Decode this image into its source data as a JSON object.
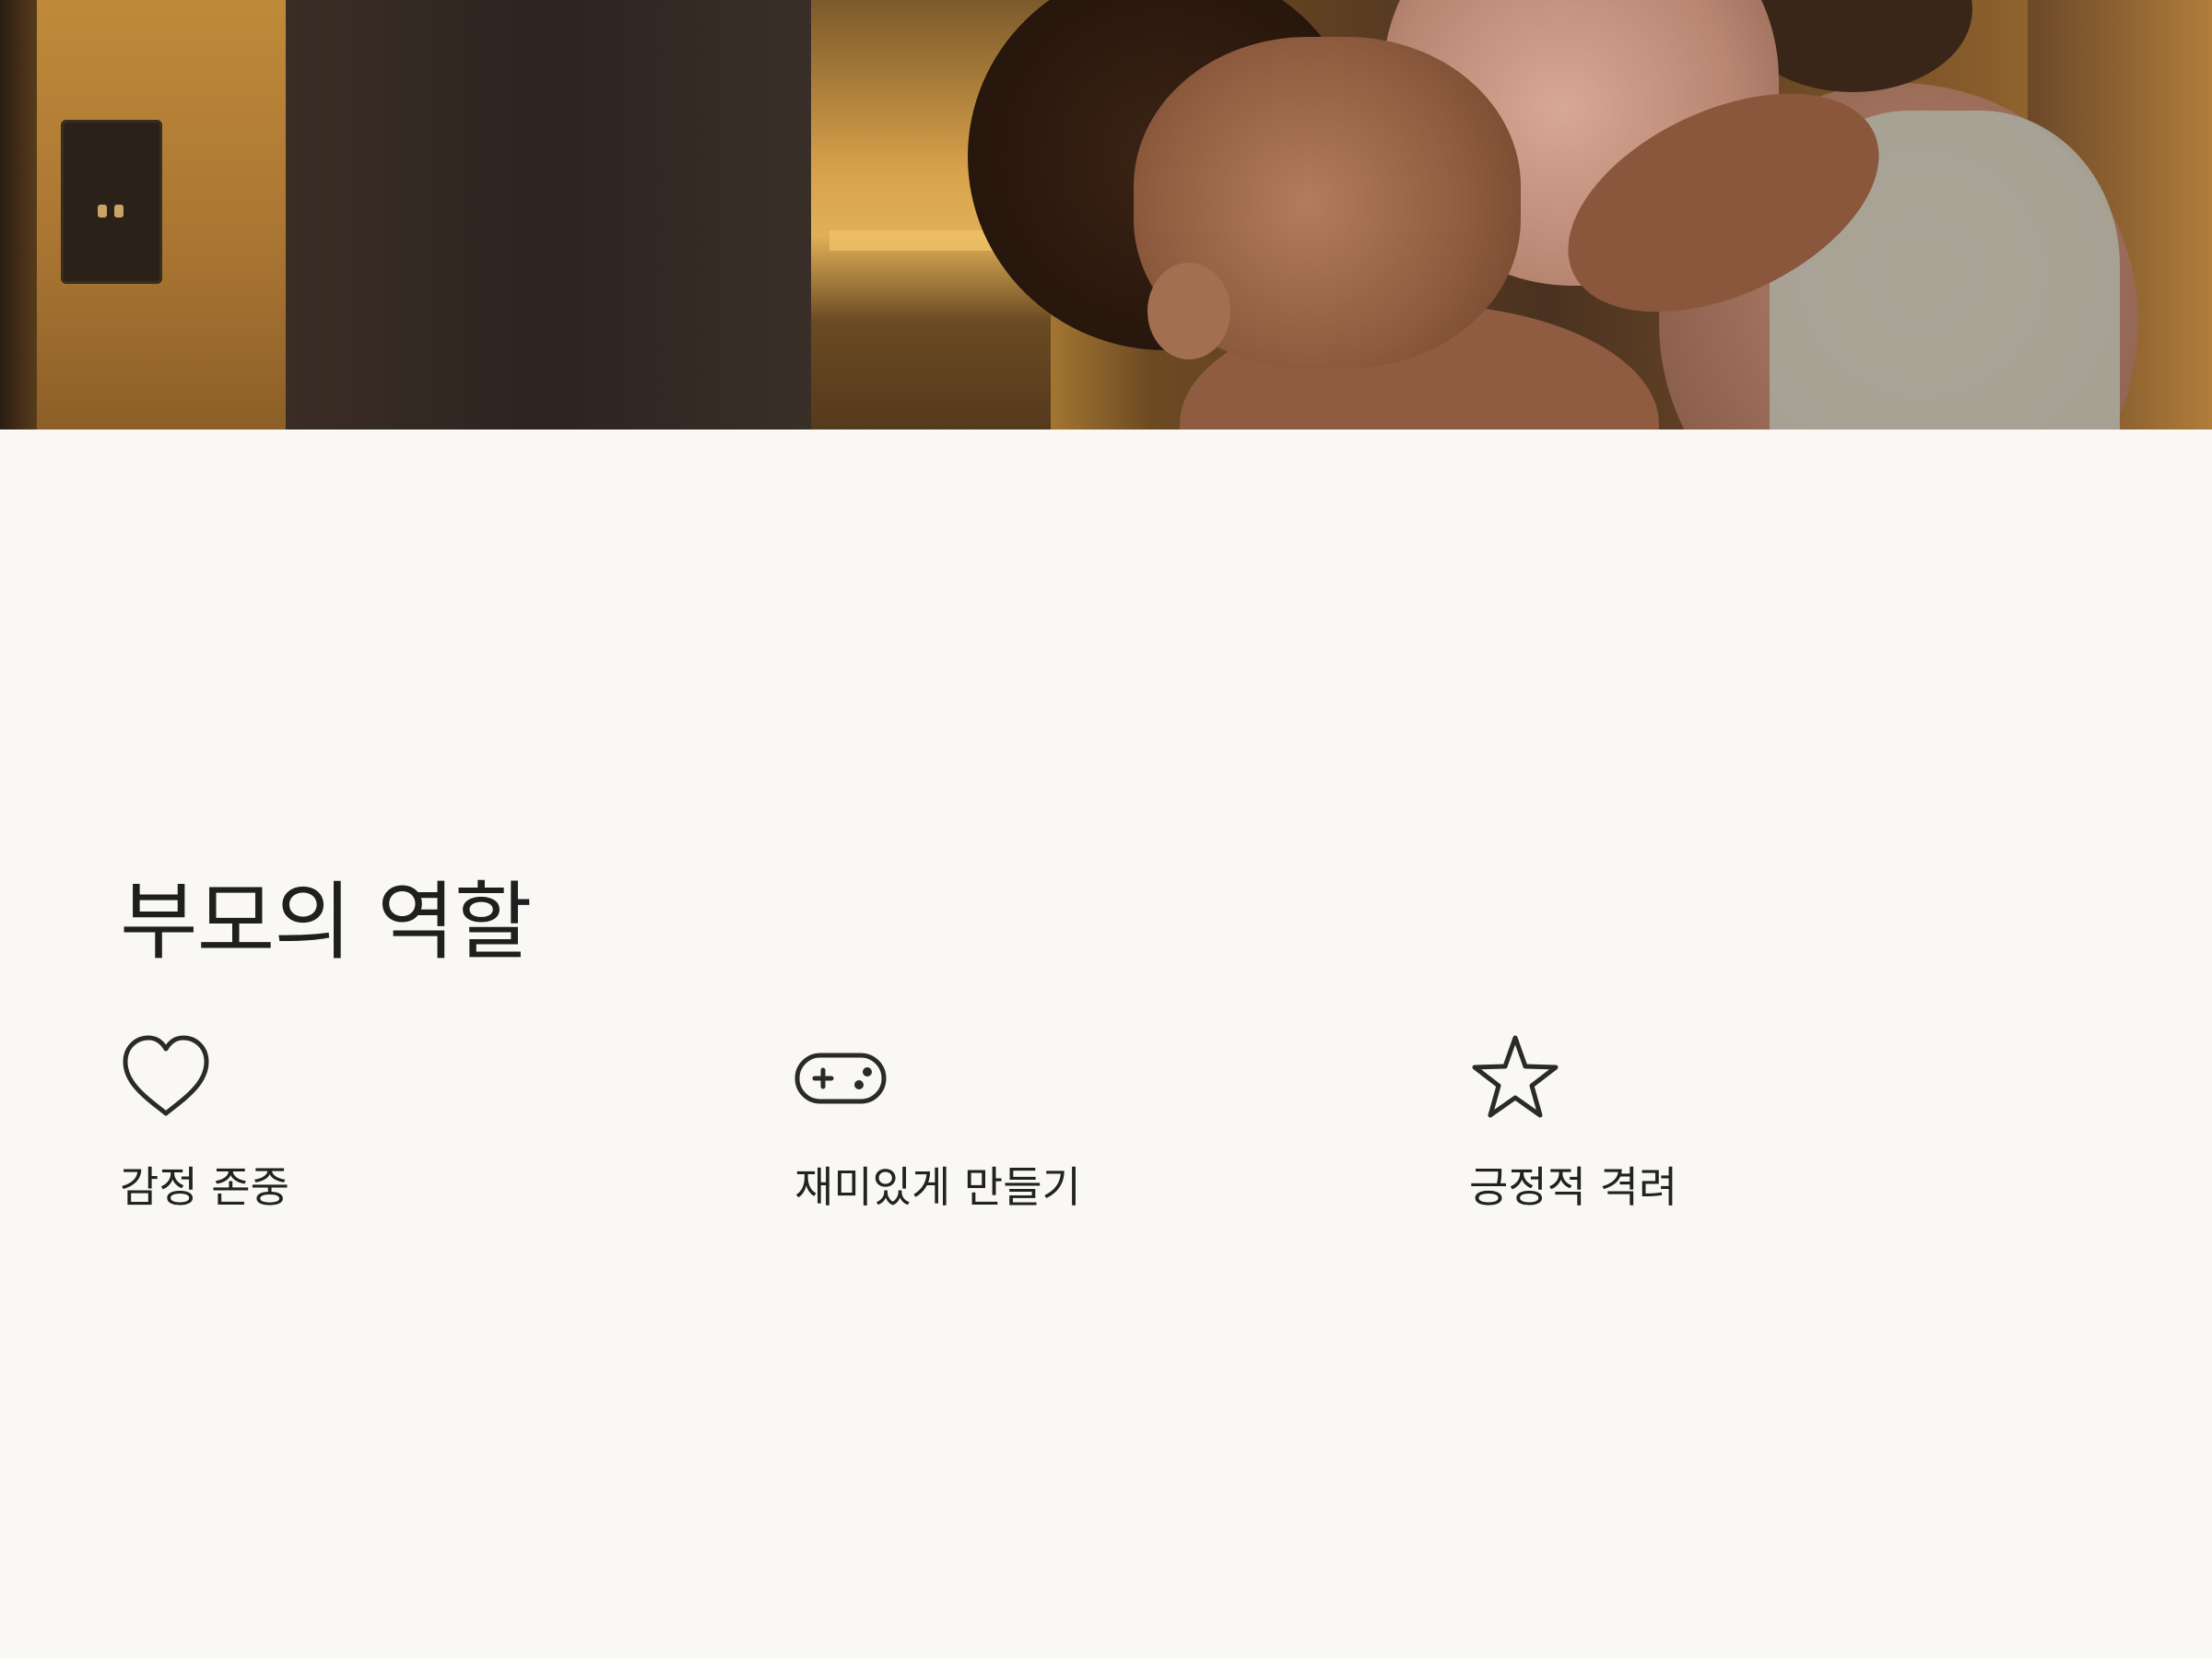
{
  "section": {
    "title": "부모의 역할"
  },
  "features": [
    {
      "icon": "heart-icon",
      "label": "감정 존중"
    },
    {
      "icon": "gamepad-icon",
      "label": "재미있게 만들기"
    },
    {
      "icon": "star-icon",
      "label": "긍정적 격려"
    }
  ],
  "colors": {
    "background": "#f9f8f4",
    "text": "#1f1f1f",
    "icon_stroke": "#2a2a2a"
  }
}
